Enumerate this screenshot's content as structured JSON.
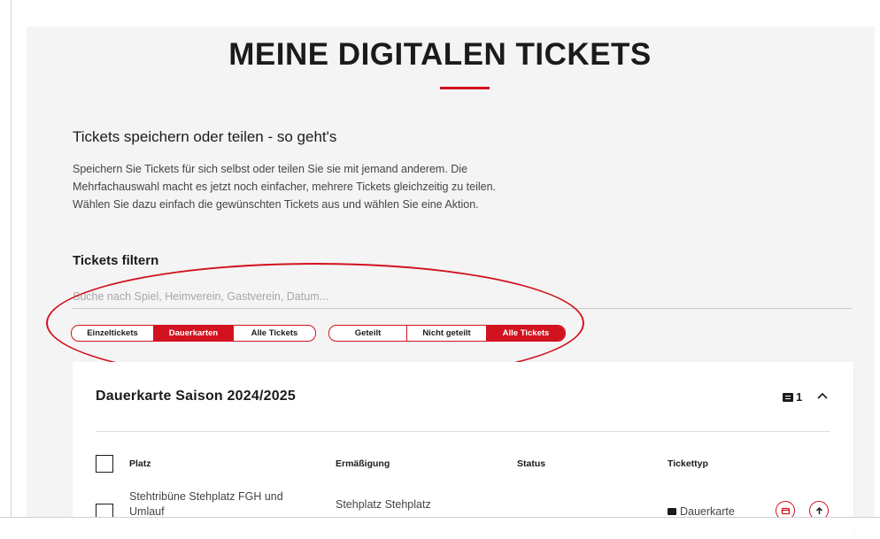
{
  "page": {
    "title": "MEINE DIGITALEN TICKETS",
    "accent_color": "#d2121f"
  },
  "intro": {
    "heading": "Tickets speichern oder teilen - so geht's",
    "lines": [
      "Speichern Sie Tickets für sich selbst oder teilen Sie sie mit jemand anderem. Die",
      "Mehrfachauswahl macht es jetzt noch einfacher, mehrere Tickets gleichzeitig zu teilen.",
      "Wählen Sie dazu einfach die gewünschten Tickets aus und wählen Sie eine Aktion."
    ]
  },
  "filter": {
    "heading": "Tickets filtern",
    "search_placeholder": "Suche nach Spiel, Heimverein, Gastverein, Datum...",
    "search_value": "",
    "type_options": [
      {
        "label": "Einzeltickets",
        "active": false
      },
      {
        "label": "Dauerkarten",
        "active": true
      },
      {
        "label": "Alle Tickets",
        "active": false
      }
    ],
    "share_options": [
      {
        "label": "Geteilt",
        "active": false
      },
      {
        "label": "Nicht geteilt",
        "active": false
      },
      {
        "label": "Alle Tickets",
        "active": true
      }
    ]
  },
  "card": {
    "title": "Dauerkarte Saison 2024/2025",
    "ticket_count": "1",
    "ticket_icon": "ticket-icon",
    "collapse_icon": "chevron-up-icon",
    "columns": {
      "platz": "Platz",
      "ermaessigung": "Ermäßigung",
      "status": "Status",
      "tickettyp": "Tickettyp"
    },
    "rows": [
      {
        "platz_line1": "Stehtribüne Stehplatz FGH und",
        "platz_line2": "Umlauf",
        "ermaessigung": "Stehplatz Stehplatz",
        "status": "",
        "tickettyp": "Dauerkarte",
        "actions": [
          "wallet-icon",
          "share-icon"
        ]
      }
    ]
  }
}
